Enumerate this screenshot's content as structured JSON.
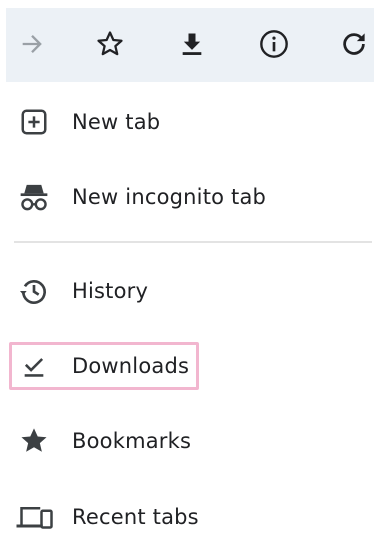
{
  "toolbar": {
    "buttons": [
      {
        "icon": "forward-arrow-icon",
        "enabled": false
      },
      {
        "icon": "star-outline-icon"
      },
      {
        "icon": "download-icon"
      },
      {
        "icon": "info-icon"
      },
      {
        "icon": "refresh-icon"
      }
    ],
    "background": "#ecf1f6"
  },
  "menu": {
    "items": [
      {
        "label": "New tab",
        "icon": "plus-box-icon"
      },
      {
        "label": "New incognito tab",
        "icon": "incognito-icon"
      },
      {
        "label": "History",
        "icon": "history-icon"
      },
      {
        "label": "Downloads",
        "icon": "download-check-icon",
        "highlighted": true
      },
      {
        "label": "Bookmarks",
        "icon": "star-filled-icon"
      },
      {
        "label": "Recent tabs",
        "icon": "devices-icon"
      }
    ],
    "highlight_color": "#f2b6cf",
    "icon_color": "#3c4043",
    "text_color": "#202124"
  }
}
